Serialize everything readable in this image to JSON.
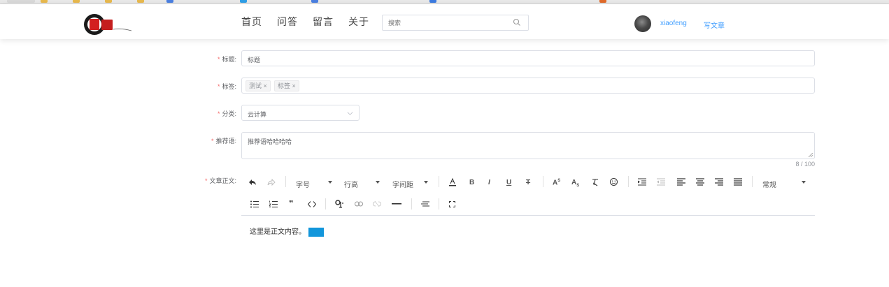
{
  "site": {
    "nav": [
      "首页",
      "问答",
      "留言",
      "关于"
    ],
    "search_placeholder": "搜索",
    "username": "xiaofeng",
    "write_label": "写文章"
  },
  "form": {
    "title_label": "标题",
    "title_value": "标题",
    "tags_label": "标签",
    "tags": [
      "测试 ×",
      "标签 ×"
    ],
    "category_label": "分类",
    "category_value": "云计算",
    "summary_label": "推荐语",
    "summary_value": "推荐语哈哈哈哈",
    "summary_counter": "8 / 100",
    "content_label": "文章正文"
  },
  "editor": {
    "font_size_label": "字号",
    "line_height_label": "行高",
    "letter_spacing_label": "字间距",
    "paragraph_style_label": "常规",
    "body_text": "这里是正文内容。"
  },
  "colors": {
    "required": "#f56c6c",
    "link": "#409eff",
    "selection": "#1296db"
  }
}
